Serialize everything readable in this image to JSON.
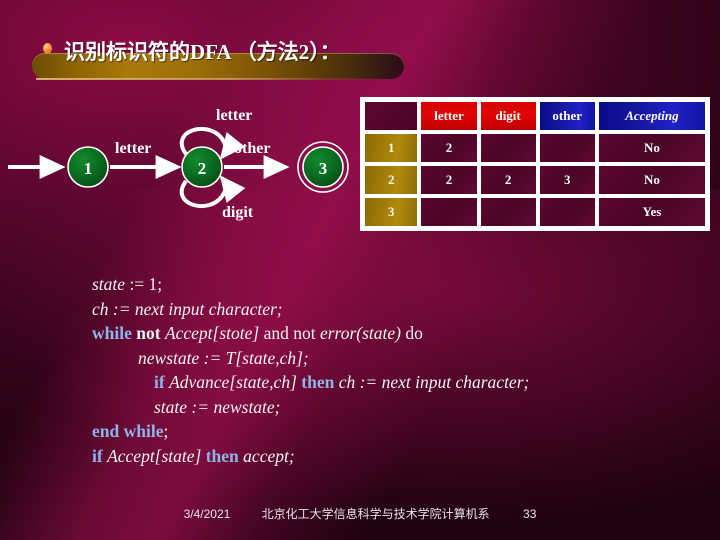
{
  "slide": {
    "title": "识别标识符的DFA （方法2）：",
    "bullet_icon": "bullet-dot-icon"
  },
  "dfa": {
    "states": [
      {
        "id": "1",
        "label": "1",
        "accepting": false
      },
      {
        "id": "2",
        "label": "2",
        "accepting": false
      },
      {
        "id": "3",
        "label": "3",
        "accepting": true
      }
    ],
    "edge_labels": {
      "start_to_1": "",
      "one_to_two": "letter",
      "two_self_top": "letter",
      "two_self_bottom": "digit",
      "two_to_three": "other"
    }
  },
  "table": {
    "corner_header": "",
    "columns": [
      "letter",
      "digit",
      "other",
      "Accepting"
    ],
    "rows": [
      {
        "state": "1",
        "letter": "2",
        "digit": "",
        "other": "",
        "accepting": "No"
      },
      {
        "state": "2",
        "letter": "2",
        "digit": "2",
        "other": "3",
        "accepting": "No"
      },
      {
        "state": "3",
        "letter": "",
        "digit": "",
        "other": "",
        "accepting": "Yes"
      }
    ]
  },
  "code": {
    "lines": [
      "state := 1;",
      "ch := next input character;",
      "while not Accept[stote] and not error(state) do",
      "newstate := T[state,ch];",
      "if Advance[state,ch] then ch := next input character;",
      "state := newstate;",
      "end while;",
      "if Accept[state] then accept;"
    ]
  },
  "footer": {
    "date": "3/4/2021",
    "organization": "北京化工大学信息科学与技术学院计算机系",
    "page_number": "33"
  },
  "colors": {
    "background_dark": "#2b0219",
    "background_mid": "#5a062e",
    "background_light": "#8c0a45",
    "title_bar_gold": "#a8790a",
    "state_green": "#0a6620",
    "header_red": "#d60000",
    "header_blue": "#1414a0",
    "row_head_gold": "#a07c08",
    "keyword_blue": "#8fb4e8"
  }
}
